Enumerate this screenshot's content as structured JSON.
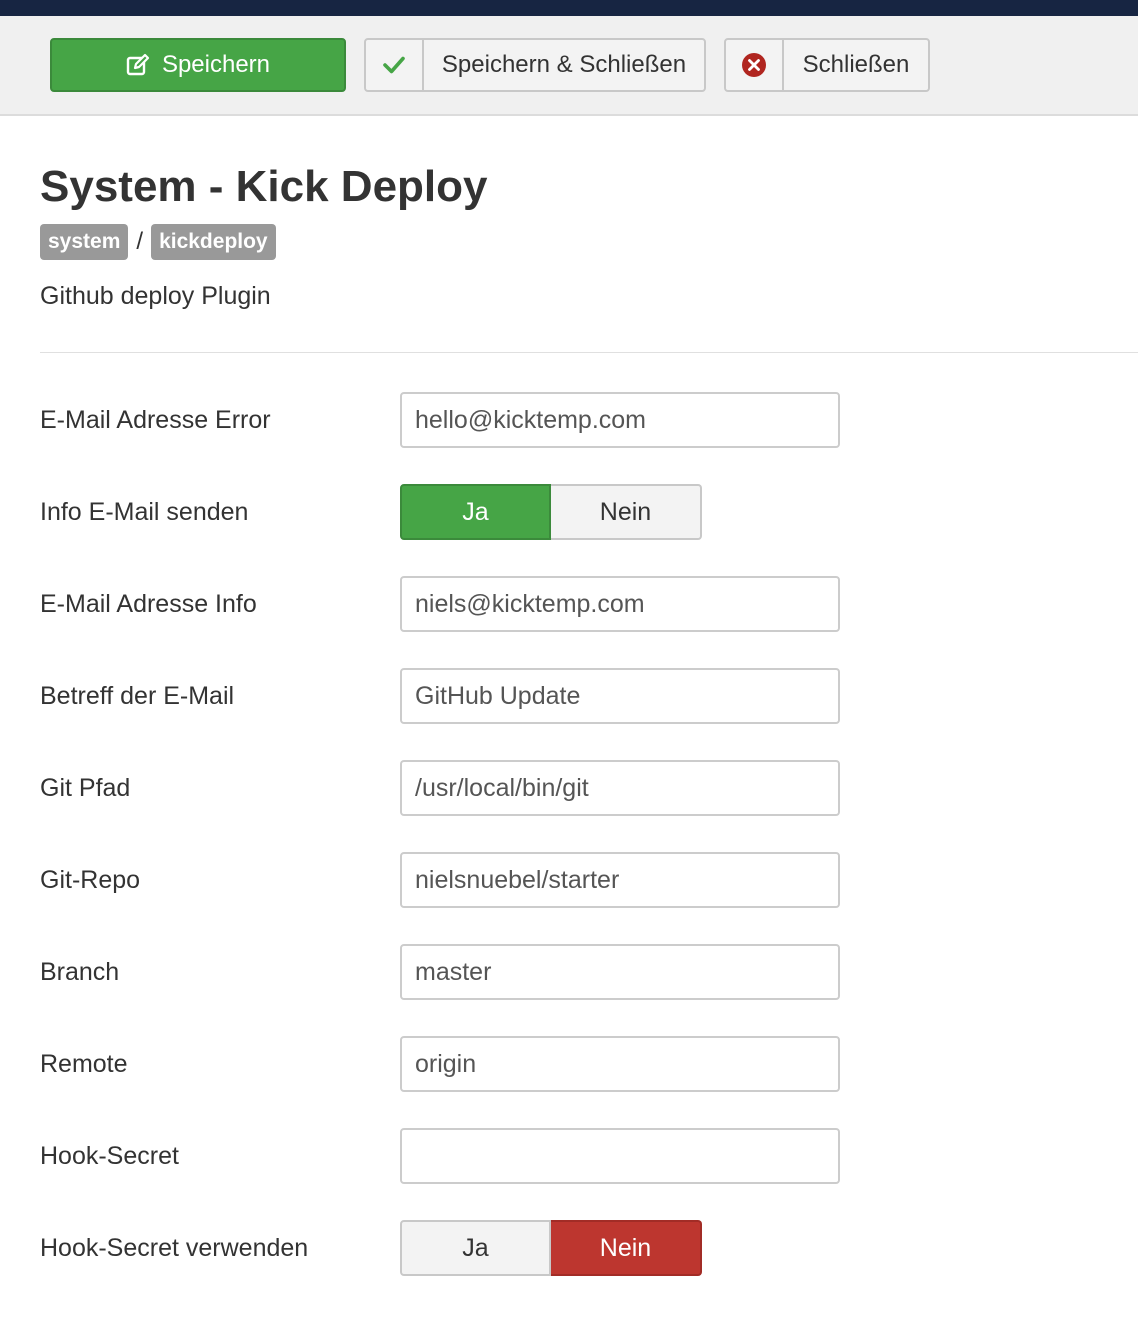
{
  "colors": {
    "header_bar": "#172542",
    "success": "#46a546",
    "danger": "#bd362f",
    "danger_icon": "#b0251f"
  },
  "toolbar": {
    "save_label": "Speichern",
    "save_icon": "edit-icon",
    "save_close_label": "Speichern & Schließen",
    "save_close_icon": "checkmark-icon",
    "close_label": "Schließen",
    "close_icon": "close-circle-icon"
  },
  "page": {
    "title": "System - Kick Deploy",
    "badges": [
      "system",
      "kickdeploy"
    ],
    "separator": "/",
    "description": "Github deploy Plugin"
  },
  "form": {
    "email_error": {
      "label": "E-Mail Adresse Error",
      "value": "hello@kicktemp.com"
    },
    "info_email": {
      "label": "Info E-Mail senden",
      "yes": "Ja",
      "no": "Nein",
      "selected": "Ja"
    },
    "email_info": {
      "label": "E-Mail Adresse Info",
      "value": "niels@kicktemp.com"
    },
    "subject": {
      "label": "Betreff der E-Mail",
      "value": "GitHub Update"
    },
    "git_path": {
      "label": "Git Pfad",
      "value": "/usr/local/bin/git"
    },
    "git_repo": {
      "label": "Git-Repo",
      "value": "nielsnuebel/starter"
    },
    "branch": {
      "label": "Branch",
      "value": "master"
    },
    "remote": {
      "label": "Remote",
      "value": "origin"
    },
    "hook_secret": {
      "label": "Hook-Secret",
      "value": ""
    },
    "use_hook_secret": {
      "label": "Hook-Secret verwenden",
      "yes": "Ja",
      "no": "Nein",
      "selected": "Nein"
    }
  }
}
